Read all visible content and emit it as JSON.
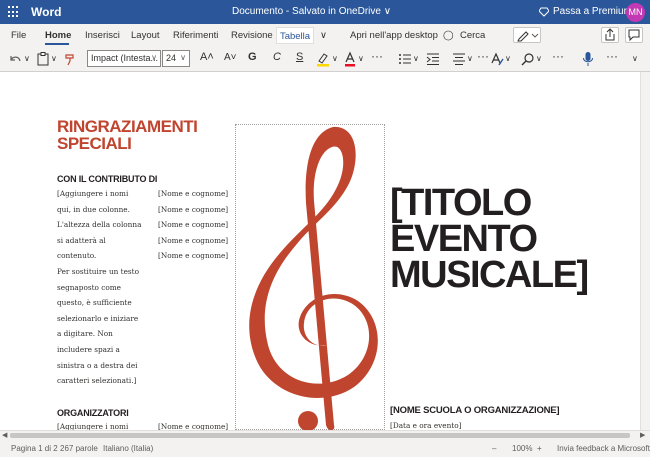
{
  "titlebar": {
    "app_name": "Word",
    "document_title": "Documento - Salvato in OneDrive ∨",
    "premium_label": "Passa a Premium",
    "avatar_initials": "MN",
    "bg_color": "#2b579a"
  },
  "tabs": {
    "items": [
      "File",
      "Home",
      "Inserisci",
      "Layout",
      "Riferimenti",
      "Revisione",
      "Tabella"
    ],
    "active": "Home",
    "open_desktop": "Apri nell'app desktop",
    "search": "Cerca"
  },
  "toolbar": {
    "font_name": "Impact (Intesta...",
    "font_size": "24",
    "grow_font": "A˄",
    "shrink_font": "A˅",
    "bold": "G",
    "italic": "C",
    "underline": "S",
    "more": "···"
  },
  "document": {
    "heading_line1": "RINGRAZIAMENTI",
    "heading_line2": "SPECIALI",
    "contrib_title": "CON IL CONTRIBUTO DI",
    "contrib_text": [
      "[Aggiungere i nomi",
      "qui, in due colonne.",
      "L'altezza della colonna",
      "si adatterà al",
      "contenuto.",
      "Per sostituire un testo",
      "segnaposto come",
      "questo, è sufficiente",
      "selezionarlo e iniziare",
      "a digitare. Non",
      "includere spazi a",
      "sinistra o a destra dei",
      "caratteri selezionati.]"
    ],
    "names": [
      "[Nome e cognome]",
      "[Nome e cognome]",
      "[Nome e cognome]",
      "[Nome e cognome]",
      "[Nome e cognome]"
    ],
    "organizers_title": "ORGANIZZATORI",
    "organizers_text": "[Aggiungere i nomi",
    "organizers_name": "[Nome e cognome]",
    "event_title_lines": [
      "[TITOLO",
      "EVENTO",
      "MUSICALE]"
    ],
    "school": "[NOME SCUOLA O ORGANIZZAZIONE]",
    "datetime": "[Data e ora evento]",
    "accent_color": "#c0452f"
  },
  "statusbar": {
    "page": "Pagina 1 di 2",
    "words": "267 parole",
    "language": "Italiano (Italia)",
    "zoom_minus": "–",
    "zoom": "100%",
    "zoom_plus": "+",
    "feedback": "Invia feedback a Microsoft"
  }
}
